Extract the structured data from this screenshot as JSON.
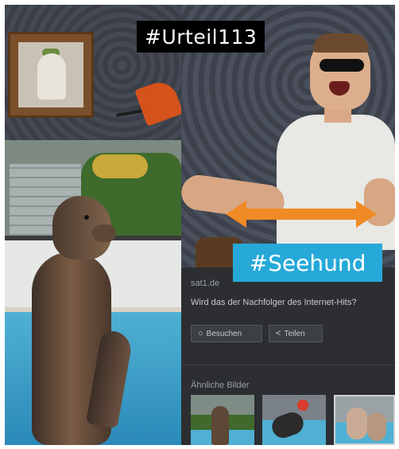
{
  "overlay": {
    "tag_top": "#Urteil113",
    "tag_bottom": "#Seehund"
  },
  "search_panel": {
    "source": "sat1.de",
    "title": "Wird das der Nachfolger des Internet-Hits?",
    "buttons": {
      "visit_label": "Besuchen",
      "share_label": "Teilen"
    },
    "similar_label": "Ähnliche Bilder",
    "thumbnails": [
      "seal",
      "sea-lion-ball",
      "walrus"
    ]
  },
  "colors": {
    "arrow": "#f08a24",
    "tag_top_bg": "#000000",
    "tag_bottom_bg": "#26a9d8",
    "panel_bg": "#2c2e31"
  },
  "icons": {
    "visit": "globe-icon",
    "share": "share-icon",
    "arrow": "double-arrow-icon"
  }
}
